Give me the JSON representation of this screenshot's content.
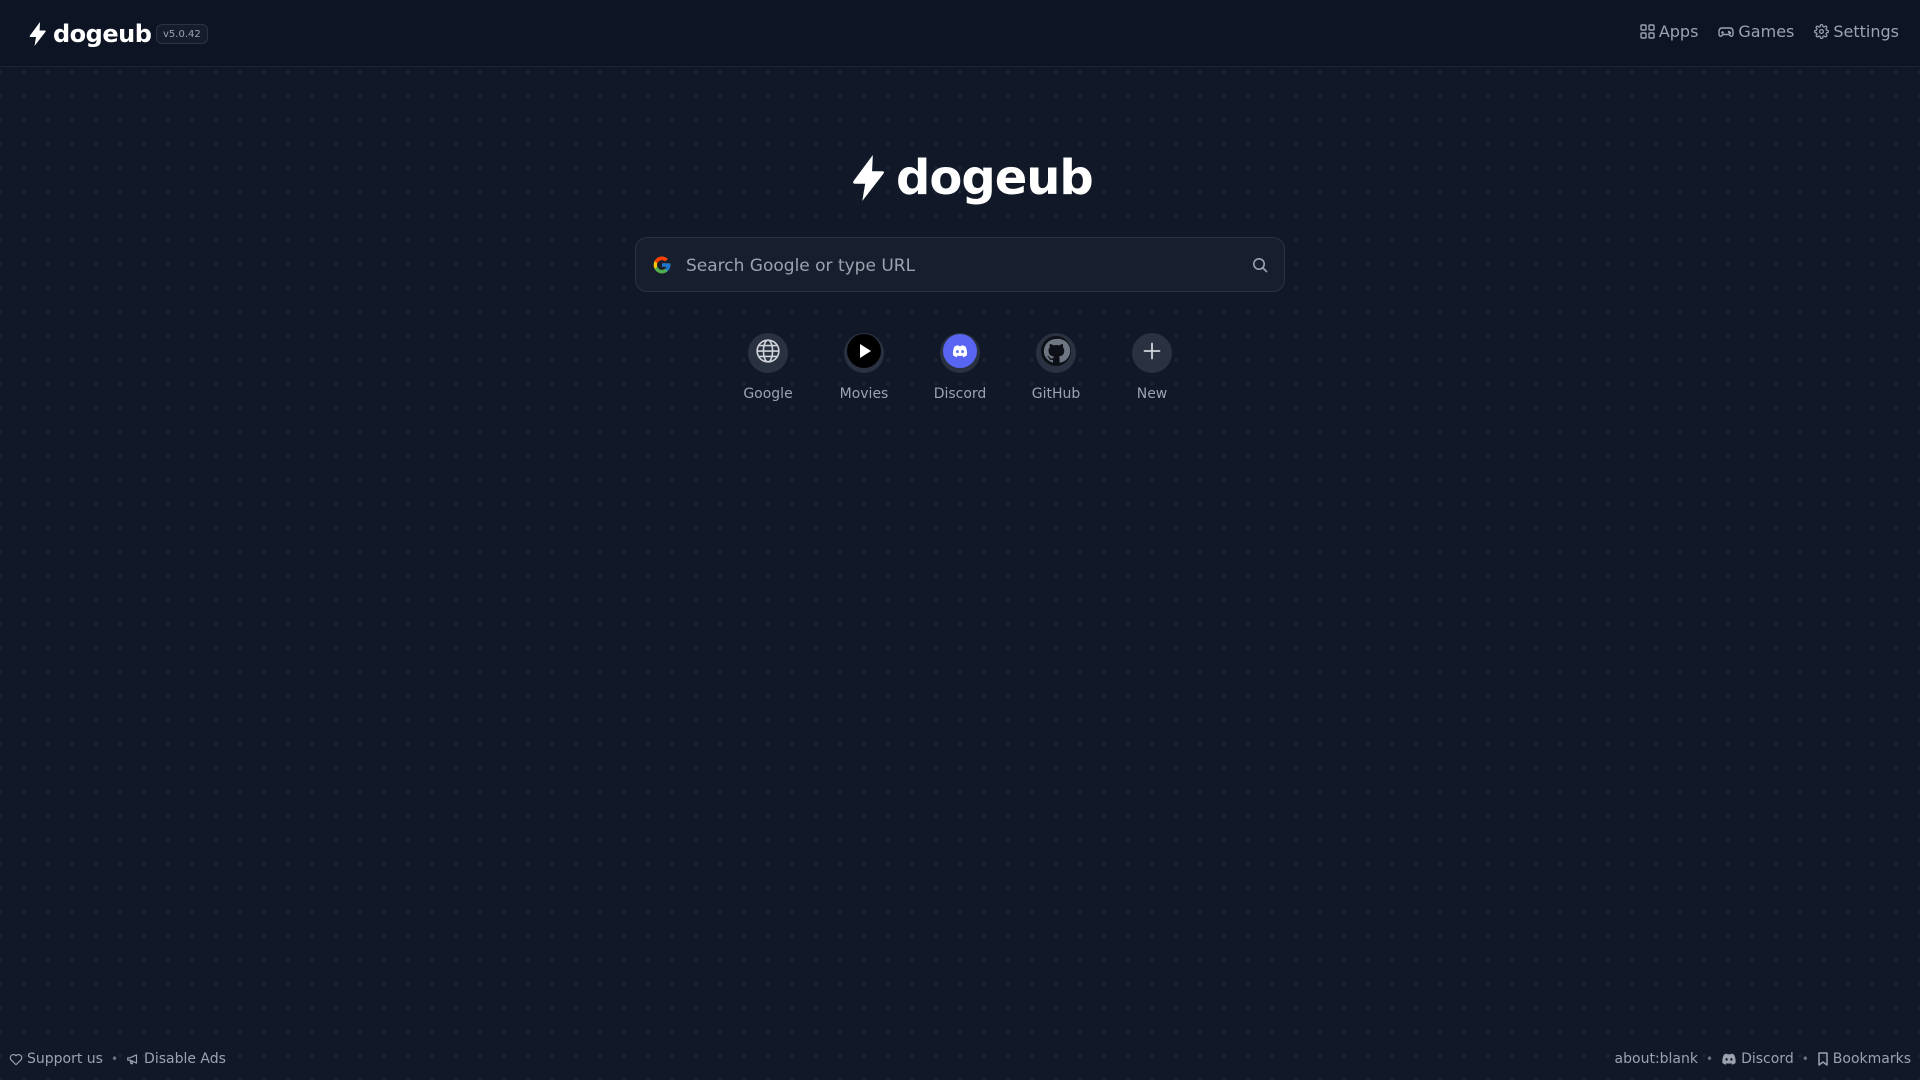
{
  "header": {
    "brand": "dogeub",
    "version": "v5.0.42",
    "nav": [
      {
        "label": "Apps",
        "icon": "grid-icon"
      },
      {
        "label": "Games",
        "icon": "gamepad-icon"
      },
      {
        "label": "Settings",
        "icon": "gear-icon"
      }
    ]
  },
  "hero": {
    "brand": "dogeub"
  },
  "search": {
    "placeholder": "Search Google or type URL",
    "engine_icon": "google-icon",
    "submit_icon": "search-icon"
  },
  "shortcuts": [
    {
      "label": "Google",
      "icon": "globe-icon"
    },
    {
      "label": "Movies",
      "icon": "play-icon"
    },
    {
      "label": "Discord",
      "icon": "discord-icon"
    },
    {
      "label": "GitHub",
      "icon": "github-icon"
    },
    {
      "label": "New",
      "icon": "plus-icon"
    }
  ],
  "footer": {
    "left": [
      {
        "label": "Support us",
        "icon": "heart-icon"
      },
      {
        "label": "Disable Ads",
        "icon": "megaphone-icon"
      }
    ],
    "right": [
      {
        "label": "about:blank"
      },
      {
        "label": "Discord",
        "icon": "discord-icon"
      },
      {
        "label": "Bookmarks",
        "icon": "bookmark-icon"
      }
    ],
    "separator": "•"
  },
  "colors": {
    "background": "#111827",
    "header_bg": "#0d1424",
    "text_muted": "#9ca3af",
    "discord_brand": "#5865F2"
  }
}
